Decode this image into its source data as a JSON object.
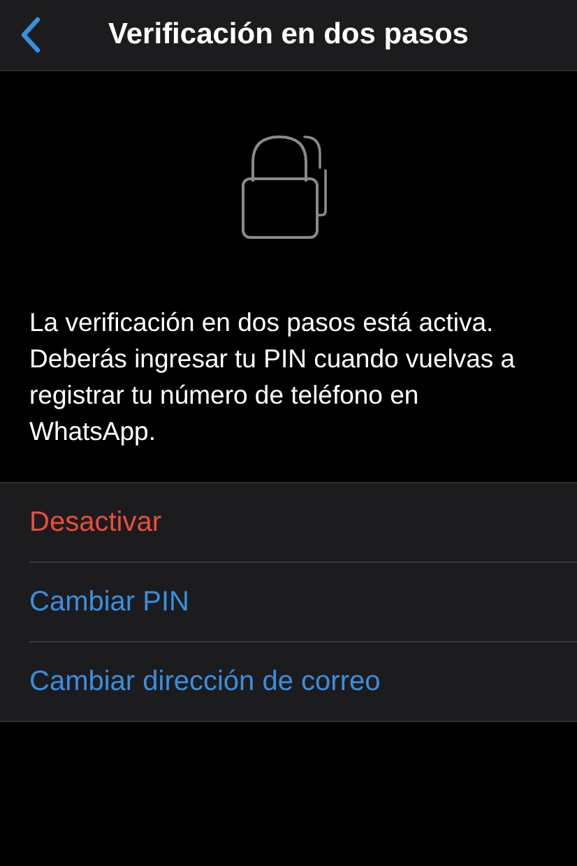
{
  "header": {
    "title": "Verificación en dos pasos"
  },
  "description": "La verificación en dos pasos está activa. Deberás ingresar tu PIN cuando vuelvas a registrar tu número de teléfono en WhatsApp.",
  "actions": [
    {
      "label": "Desactivar",
      "kind": "destructive"
    },
    {
      "label": "Cambiar PIN",
      "kind": "default"
    },
    {
      "label": "Cambiar dirección de correo",
      "kind": "default"
    }
  ]
}
